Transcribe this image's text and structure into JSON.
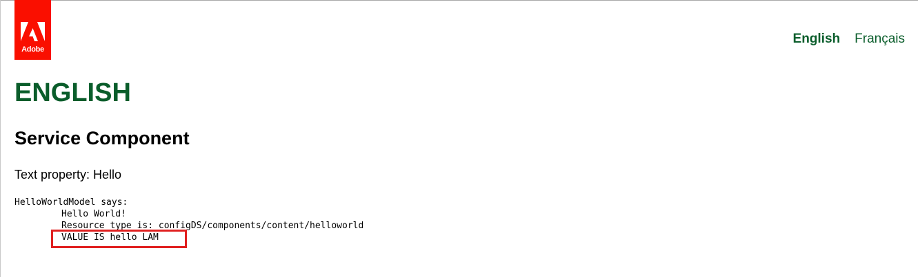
{
  "logo": {
    "word": "Adobe",
    "icon": "adobe-logo-icon",
    "color": "#fa0f00"
  },
  "nav": {
    "languages": [
      {
        "label": "English",
        "active": true
      },
      {
        "label": "Français",
        "active": false
      }
    ],
    "color": "#0a5d2b"
  },
  "page": {
    "title": "ENGLISH",
    "section_title": "Service Component",
    "text_property": "Text property: Hello"
  },
  "output": {
    "header": "HelloWorldModel says:",
    "lines": [
      "Hello World!",
      "Resource type is: configDS/components/content/helloworld",
      "VALUE IS hello LAM"
    ]
  },
  "annotation": {
    "box_color": "#e02020"
  }
}
